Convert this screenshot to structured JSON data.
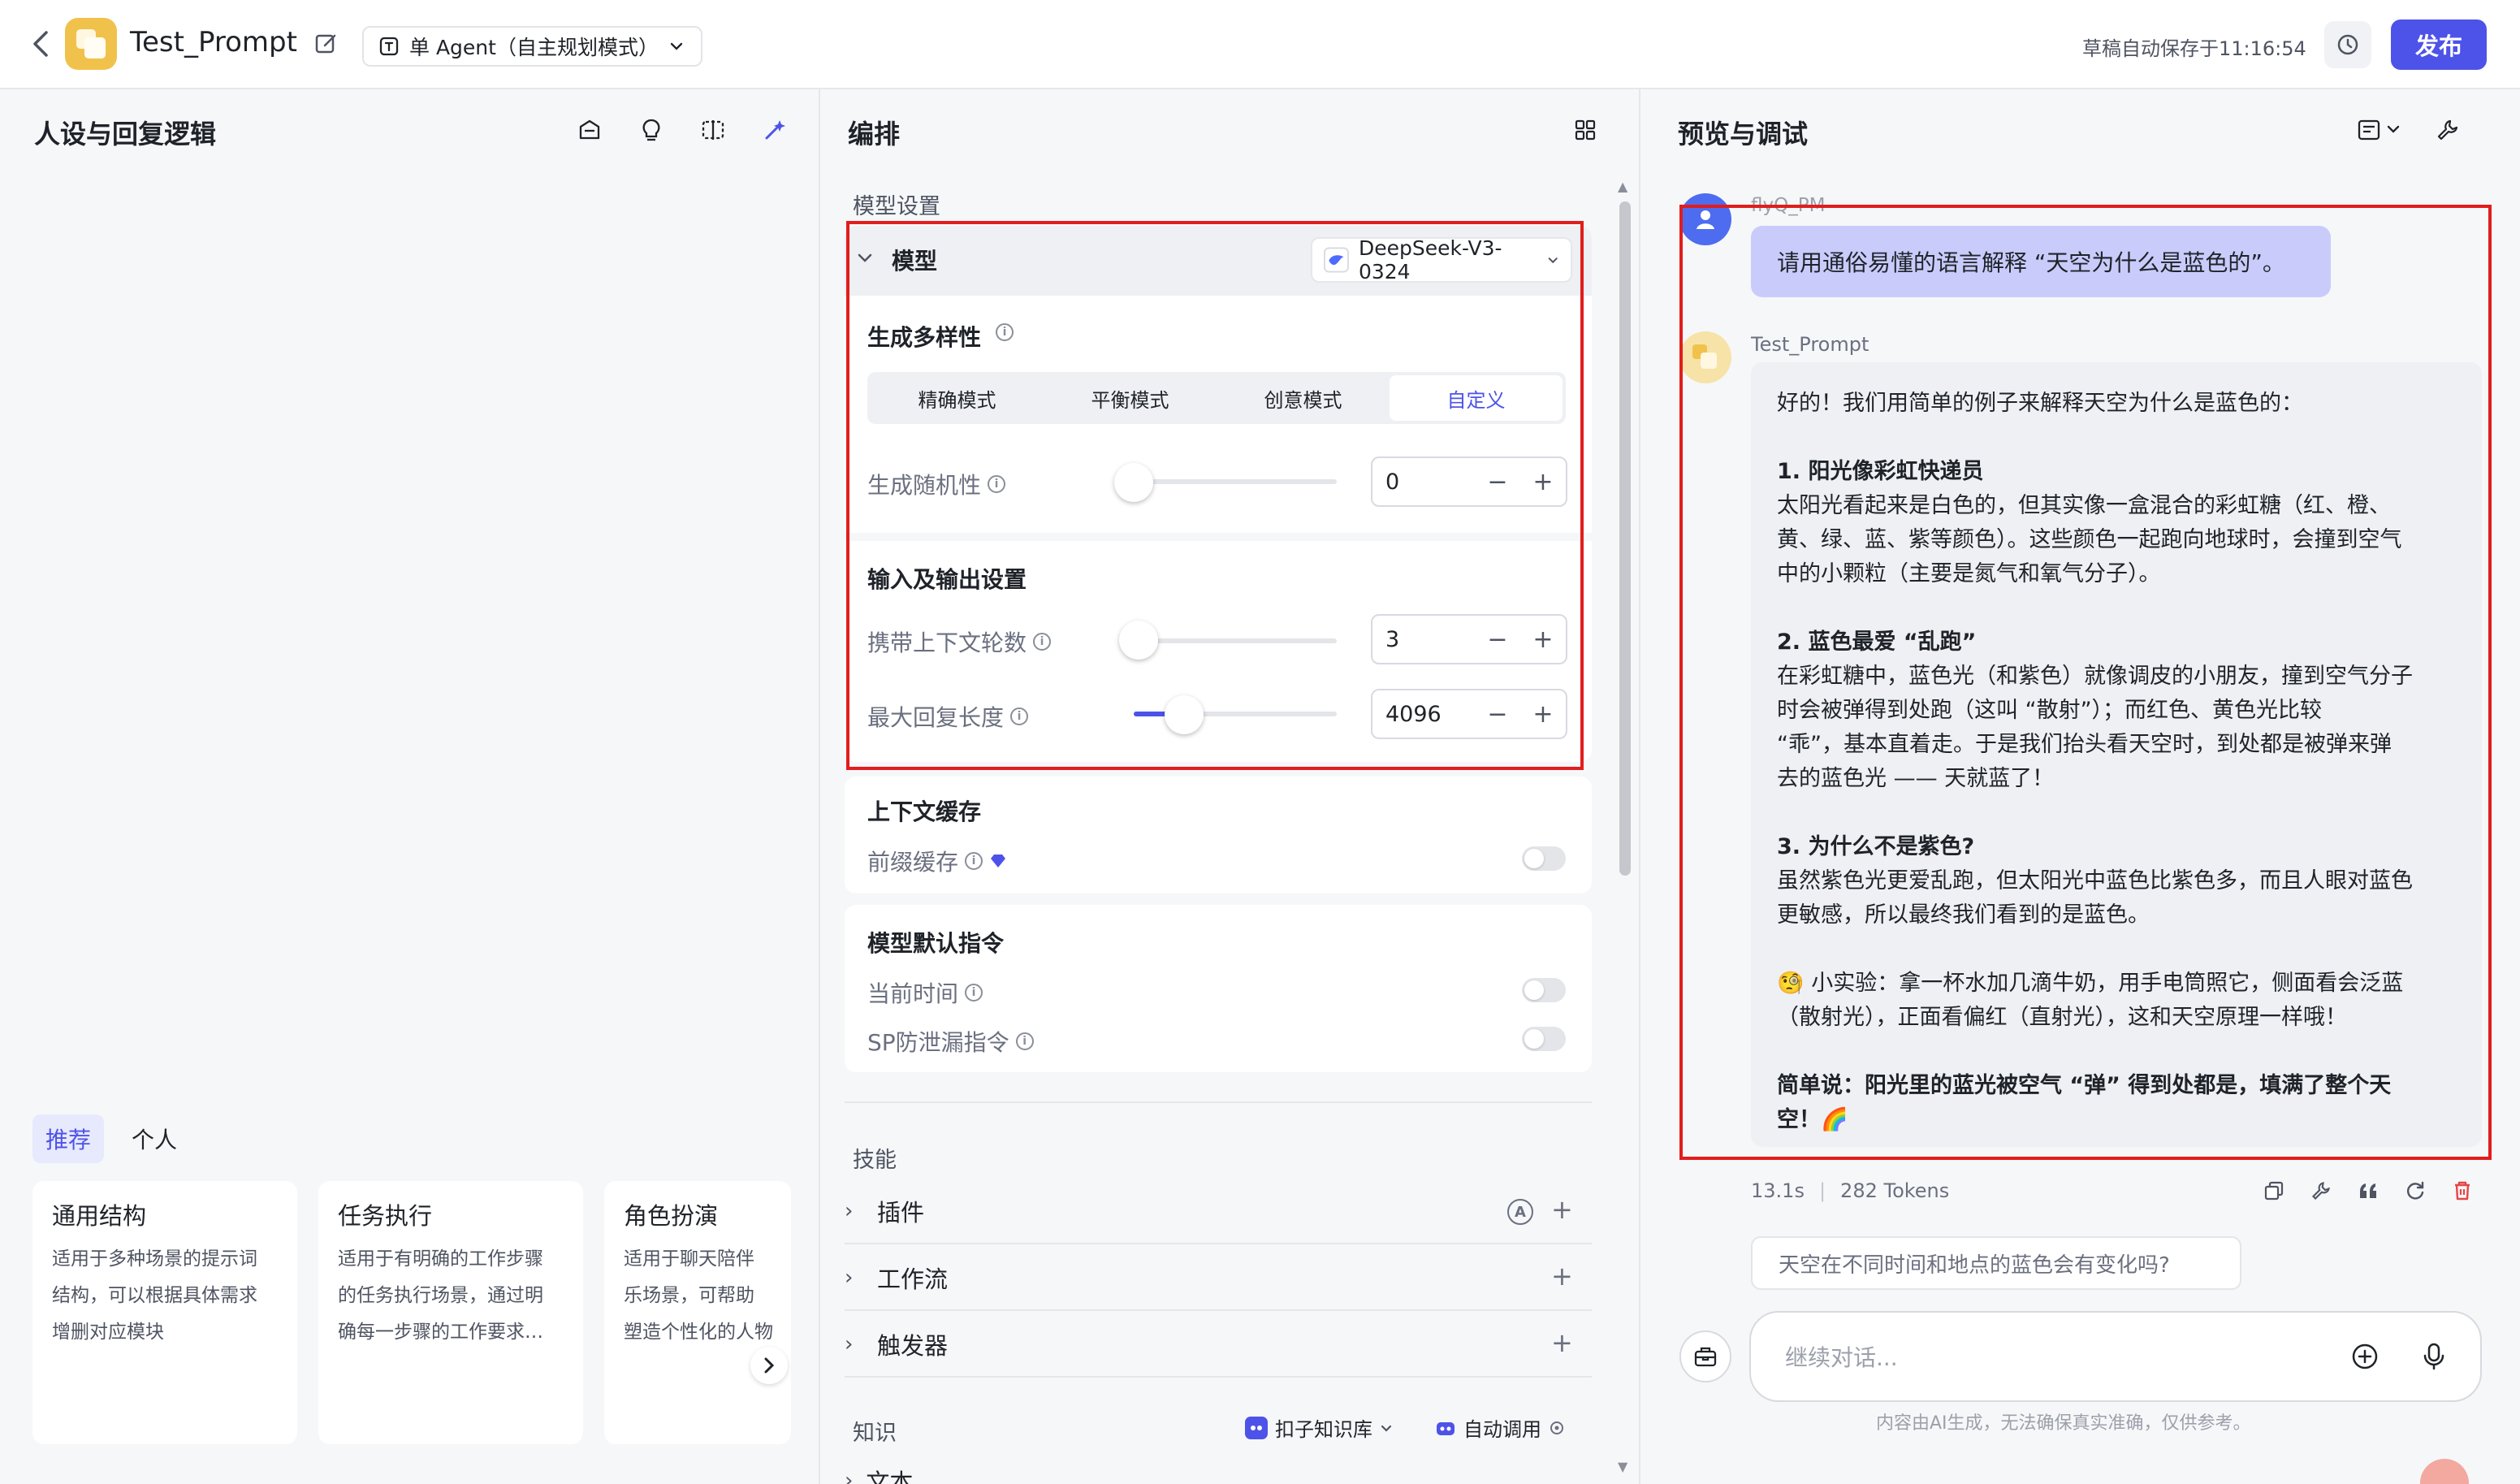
{
  "header": {
    "app_title": "Test_Prompt",
    "mode_label": "单 Agent（自主规划模式）",
    "draft_status": "草稿自动保存于11:16:54",
    "publish_label": "发布"
  },
  "left": {
    "title": "人设与回复逻辑",
    "tabs": [
      "推荐",
      "个人"
    ],
    "templates": [
      {
        "title": "通用结构",
        "desc": [
          "适用于多种场景的提示词",
          "结构，可以根据具体需求",
          "增删对应模块"
        ]
      },
      {
        "title": "任务执行",
        "desc": [
          "适用于有明确的工作步骤",
          "的任务执行场景，通过明",
          "确每一步骤的工作要求…"
        ]
      },
      {
        "title": "角色扮演",
        "desc": [
          "适用于聊天陪伴",
          "乐场景，可帮助",
          "塑造个性化的人物"
        ]
      }
    ]
  },
  "mid": {
    "title": "编排",
    "model_settings_label": "模型设置",
    "model_label": "模型",
    "model_name": "DeepSeek-V3-0324",
    "diversity_label": "生成多样性",
    "modes": [
      "精确模式",
      "平衡模式",
      "创意模式",
      "自定义"
    ],
    "active_mode": "自定义",
    "randomness_label": "生成随机性",
    "randomness_value": "0",
    "io_label": "输入及输出设置",
    "context_rounds_label": "携带上下文轮数",
    "context_rounds_value": "3",
    "max_len_label": "最大回复长度",
    "max_len_value": "4096",
    "cache_title": "上下文缓存",
    "prefix_cache_label": "前缀缓存",
    "default_instr_title": "模型默认指令",
    "current_time_label": "当前时间",
    "sp_leak_label": "SP防泄漏指令",
    "skills_label": "技能",
    "skills": [
      "插件",
      "工作流",
      "触发器"
    ],
    "knowledge_label": "知识",
    "kb_label": "扣子知识库",
    "auto_call_label": "自动调用",
    "text_label": "文本",
    "minus": "−",
    "plus": "+"
  },
  "right": {
    "title": "预览与调试",
    "user_name": "flyQ_PM",
    "user_message": "请用通俗易懂的语言解释 “天空为什么是蓝色的”。",
    "bot_name": "Test_Prompt",
    "bot_paragraphs": [
      "好的！我们用简单的例子来解释天空为什么是蓝色的：",
      "",
      "1. 阳光像彩虹快递员",
      "太阳光看起来是白色的，但其实像一盒混合的彩虹糖（红、橙、",
      "黄、绿、蓝、紫等颜色）。这些颜色一起跑向地球时，会撞到空气",
      "中的小颗粒（主要是氮气和氧气分子）。",
      "",
      "2. 蓝色最爱 “乱跑”",
      "在彩虹糖中，蓝色光（和紫色）就像调皮的小朋友，撞到空气分子",
      "时会被弹得到处跑（这叫 “散射”）；而红色、黄色光比较",
      "“乖”，基本直着走。于是我们抬头看天空时，到处都是被弹来弹",
      "去的蓝色光 —— 天就蓝了！",
      "",
      "3. 为什么不是紫色?",
      "虽然紫色光更爱乱跑，但太阳光中蓝色比紫色多，而且人眼对蓝色",
      "更敏感，所以最终我们看到的是蓝色。",
      "",
      "🧐 小实验：拿一杯水加几滴牛奶，用手电筒照它，侧面看会泛蓝",
      "（散射光），正面看偏红（直射光），这和天空原理一样哦！",
      "",
      "简单说：阳光里的蓝光被空气 “弹” 得到处都是，填满了整个天",
      "空！🌈"
    ],
    "elapsed": "13.1s",
    "tokens": "282 Tokens",
    "suggestion": "天空在不同时间和地点的蓝色会有变化吗?",
    "input_placeholder": "继续对话...",
    "disclaimer": "内容由AI生成，无法确保真实准确，仅供参考。"
  },
  "colors": {
    "accent": "#4d53e8",
    "highlight_box": "#e21d1d",
    "user_bubble": "#c9ccfb",
    "bot_bubble": "#eef0f3",
    "delete_icon": "#e54545"
  }
}
